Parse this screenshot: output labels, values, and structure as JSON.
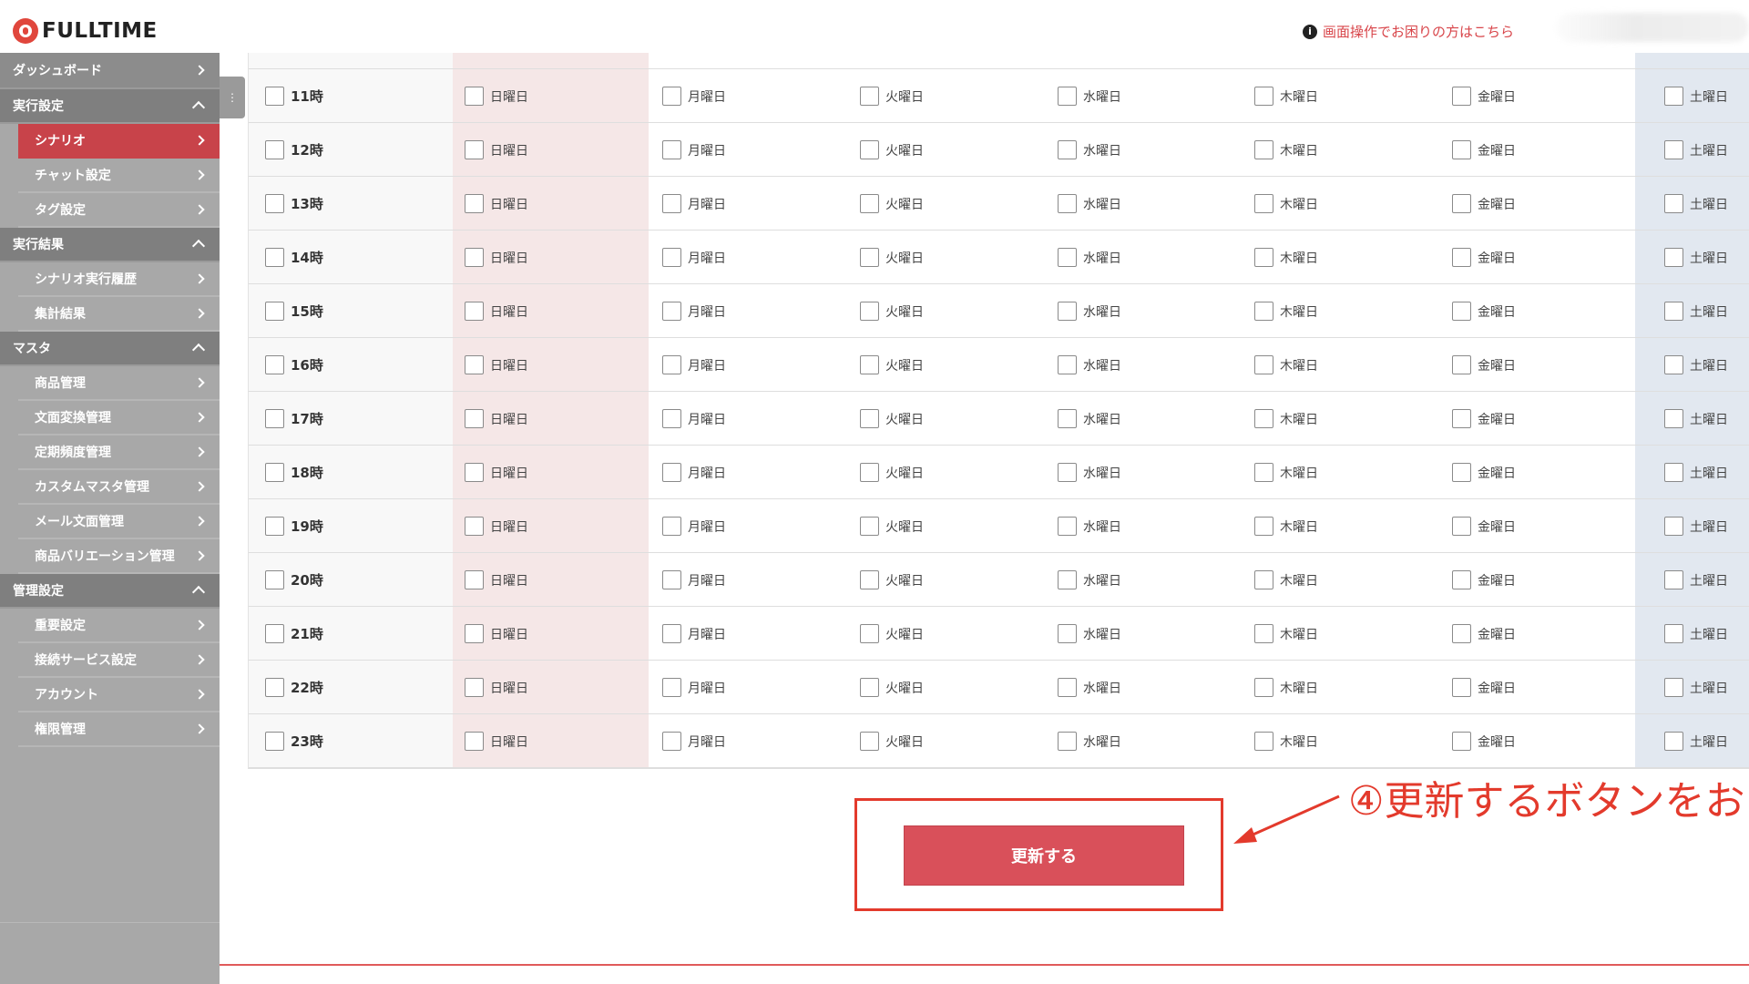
{
  "header": {
    "logo_text": "FULLTIME",
    "help_link": "画面操作でお困りの方はこちら"
  },
  "sidebar": {
    "top_item": "ダッシュボード",
    "sections": [
      {
        "title": "実行設定",
        "items": [
          "シナリオ",
          "チャット設定",
          "タグ設定"
        ]
      },
      {
        "title": "実行結果",
        "items": [
          "シナリオ実行履歴",
          "集計結果"
        ]
      },
      {
        "title": "マスタ",
        "items": [
          "商品管理",
          "文面変換管理",
          "定期頻度管理",
          "カスタムマスタ管理",
          "メール文面管理",
          "商品バリエーション管理"
        ]
      },
      {
        "title": "管理設定",
        "items": [
          "重要設定",
          "接続サービス設定",
          "アカウント",
          "権限管理"
        ]
      }
    ],
    "active_item": "シナリオ"
  },
  "schedule": {
    "days": [
      "日曜日",
      "月曜日",
      "火曜日",
      "水曜日",
      "木曜日",
      "金曜日",
      "土曜日"
    ],
    "hours": [
      "11時",
      "12時",
      "13時",
      "14時",
      "15時",
      "16時",
      "17時",
      "18時",
      "19時",
      "20時",
      "21時",
      "22時",
      "23時"
    ]
  },
  "submit": {
    "label": "更新する"
  },
  "annotation": {
    "text": "④更新するボタンをお"
  },
  "colors": {
    "accent": "#d9505a",
    "annotation": "#e33a2c",
    "sidebar": "#a8a8a8"
  }
}
